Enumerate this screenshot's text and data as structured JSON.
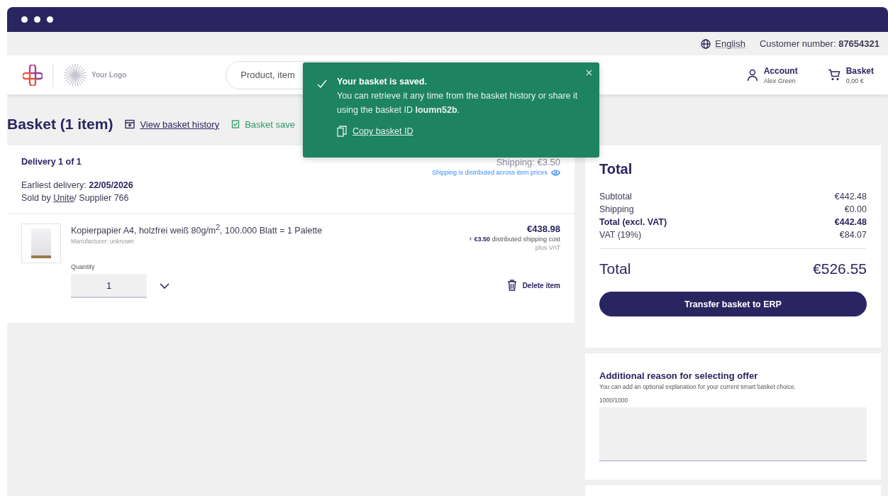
{
  "utility_bar": {
    "language": "English",
    "customer": "Customer number: **87654321**"
  },
  "header": {
    "logo_text": "Your Logo",
    "search": {
      "placeholder": "Product, item"
    },
    "account": {
      "label": "Account",
      "name": "Alex Green"
    },
    "basket": {
      "label": "Basket",
      "amount": "0,00 €"
    }
  },
  "page_title": "Basket (1 item)",
  "history_link": "View basket history",
  "saved_status": "Basket save",
  "delivery": {
    "title": "Delivery 1 of 1",
    "shipping": "Shipping: €3.50",
    "shipping_note": "Shipping is distributed across item prices",
    "earliest": "Earliest delivery: **22/05/2026**",
    "sold_by": "Sold by ",
    "supplier_link": "Unite",
    "supplier_rest": "/ Supplier 766"
  },
  "item": {
    "name": "Kopierpapier A4, holzfrei weiß 80g/m$^{2}$, 100.000 Blatt = 1 Palette",
    "manufacturer": "Manufacturer: unknown",
    "price": "€438.98",
    "shipping_note": "+ **€3.50** distributed shipping cost",
    "vat_note": "plus VAT",
    "quantity_label": "Quantity",
    "quantity": "1",
    "delete": "Delete item"
  },
  "summary": {
    "title": "Total",
    "rows": [
      {
        "label": "Subtotal",
        "value": "€442.48",
        "bold": false
      },
      {
        "label": "Shipping",
        "value": "€0.00",
        "bold": false
      },
      {
        "label": "Total (excl. VAT)",
        "value": "€442.48",
        "bold": true
      },
      {
        "label": "VAT (19%)",
        "value": "€84.07",
        "bold": false
      }
    ],
    "total_label": "Total",
    "total_value": "€526.55",
    "button": "Transfer basket to ERP"
  },
  "reason": {
    "title": "Additional reason for selecting offer",
    "subtitle": "You can add an optional explanation for your current smart basket choice.",
    "counter": "1000/1000"
  },
  "toast": {
    "title": "Your basket is saved.",
    "message": "You can retrieve it any time from the basket history or share it using the basket ID **loumn52b**.",
    "action": "Copy basket ID"
  }
}
